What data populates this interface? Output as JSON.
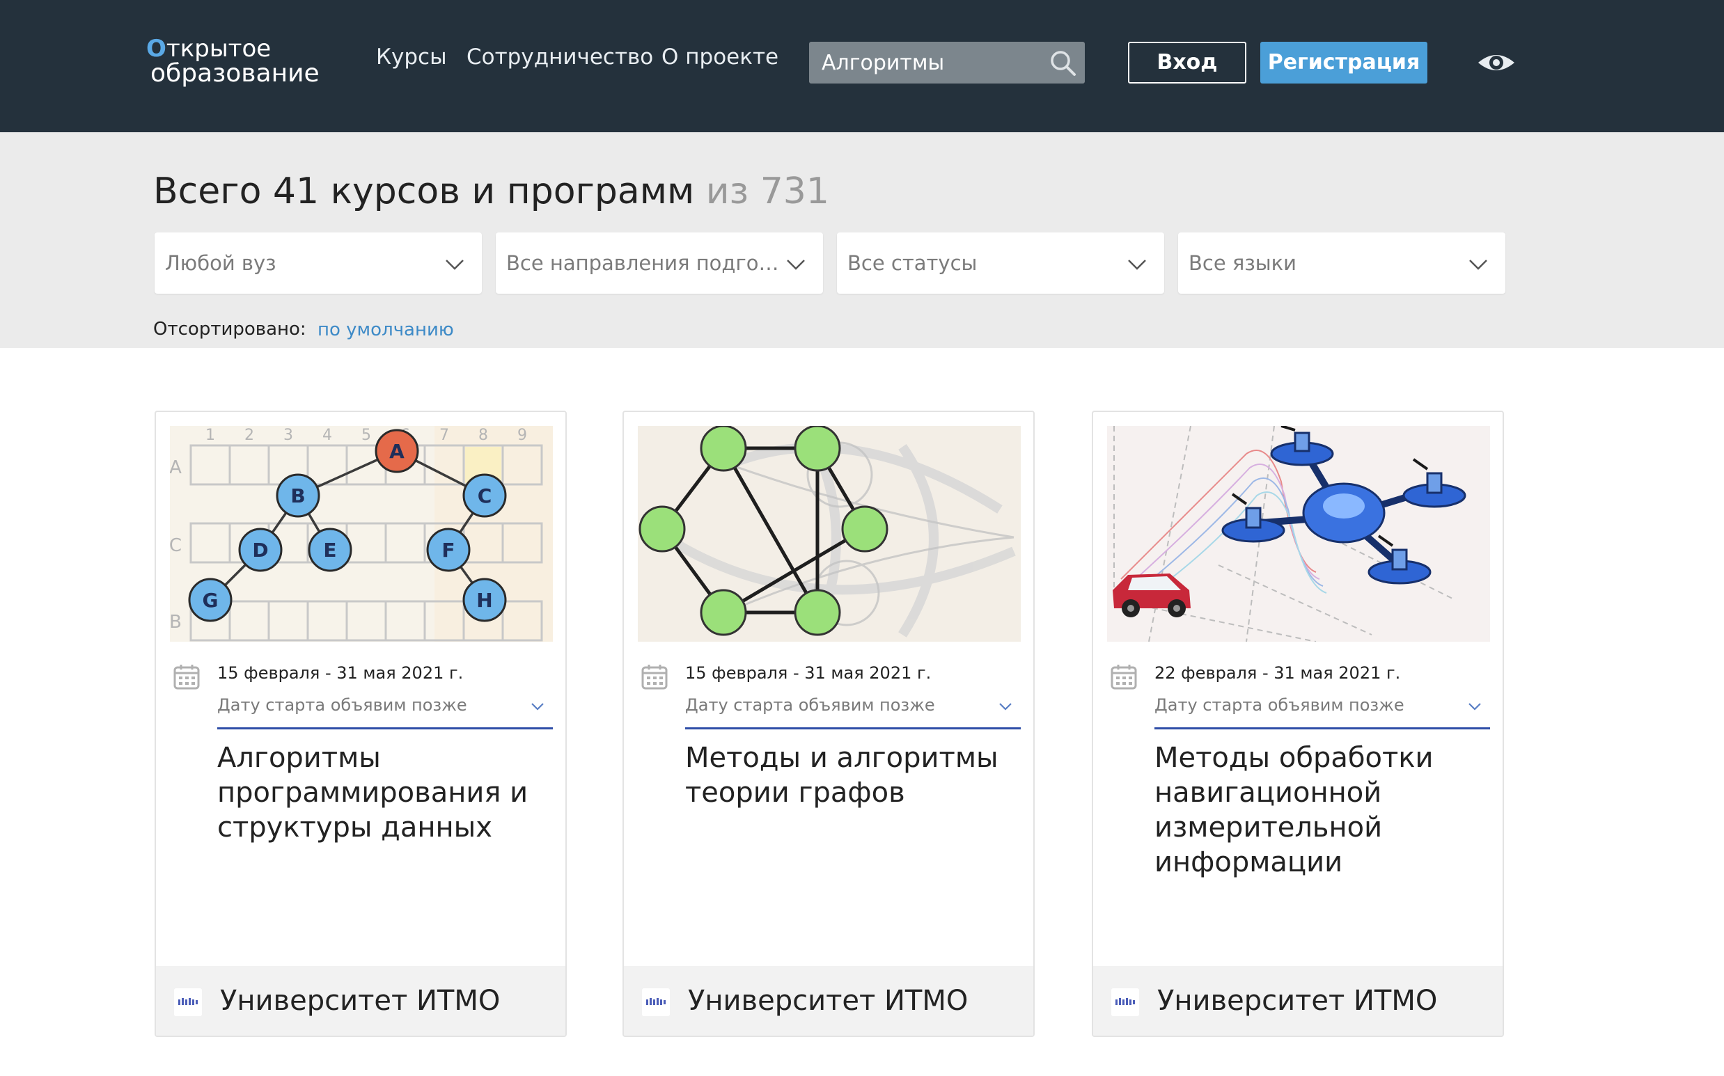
{
  "header": {
    "logo": {
      "line1_o": "О",
      "line1_rest": "ткрытое",
      "line2": "образование"
    },
    "nav": [
      "Курсы",
      "Сотрудничество",
      "О проекте"
    ],
    "search": {
      "value": "Алгоритмы",
      "placeholder": ""
    },
    "login_label": "Вход",
    "register_label": "Регистрация",
    "colors": {
      "background": "#24313c",
      "accent": "#4b9fd8"
    }
  },
  "results": {
    "prefix": "Всего 41 курсов и программ",
    "total": "из 731"
  },
  "filters": [
    {
      "label": "Любой вуз"
    },
    {
      "label": "Все направления подготов..."
    },
    {
      "label": "Все статусы"
    },
    {
      "label": "Все языки"
    }
  ],
  "sort": {
    "label": "Отсортировано:",
    "value": "по умолчанию"
  },
  "cards": [
    {
      "dates": "15 февраля - 31 мая 2021 г.",
      "start_note": "Дату старта объявим позже",
      "title": "Алгоритмы программирования и структуры данных",
      "university": "Университет ИТМО",
      "image": {
        "col_labels": [
          "1",
          "2",
          "3",
          "4",
          "5",
          "6",
          "7",
          "8",
          "9"
        ],
        "row_labels": [
          "A",
          "C",
          "B"
        ],
        "nodes": [
          "A",
          "B",
          "C",
          "D",
          "E",
          "F",
          "G",
          "H"
        ]
      }
    },
    {
      "dates": "15 февраля - 31 мая 2021 г.",
      "start_note": "Дату старта объявим позже",
      "title": "Методы и алгоритмы теории графов",
      "university": "Университет ИТМО"
    },
    {
      "dates": "22 февраля - 31 мая 2021 г.",
      "start_note": "Дату старта объявим позже",
      "title": "Методы обработки навигационной измерительной информации",
      "university": "Университет ИТМО"
    }
  ],
  "icons": {
    "search": "search-icon",
    "eye": "eye-icon",
    "chevron": "chevron-down-icon",
    "calendar": "calendar-icon",
    "university_logo": "itmo-logo-icon"
  }
}
